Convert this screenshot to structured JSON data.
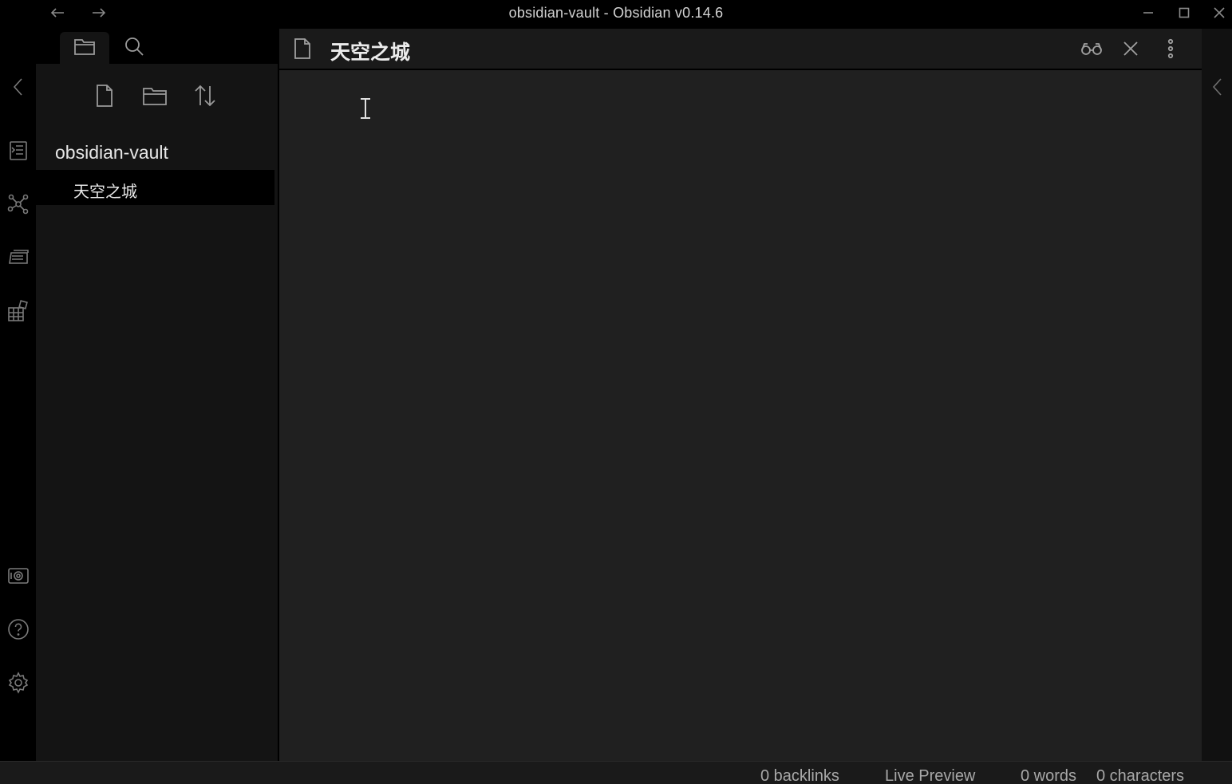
{
  "titlebar": {
    "title": "obsidian-vault - Obsidian v0.14.6",
    "back_icon": "arrow-left-icon",
    "forward_icon": "arrow-right-icon",
    "minimize_icon": "minimize-icon",
    "maximize_icon": "maximize-icon",
    "close_icon": "close-icon"
  },
  "ribbon": {
    "items": [
      {
        "icon": "chevron-left-icon"
      },
      {
        "icon": "command-palette-icon"
      },
      {
        "icon": "graph-view-icon"
      },
      {
        "icon": "slides-icon"
      },
      {
        "icon": "daily-notes-icon"
      },
      {
        "icon": "vault-icon"
      },
      {
        "icon": "help-icon"
      },
      {
        "icon": "settings-icon"
      }
    ]
  },
  "sidebar": {
    "tabs": [
      {
        "icon": "folder-icon",
        "active": true
      },
      {
        "icon": "search-icon",
        "active": false
      }
    ],
    "actions": [
      {
        "icon": "new-note-icon"
      },
      {
        "icon": "new-folder-icon"
      },
      {
        "icon": "sort-icon"
      }
    ],
    "vault_name": "obsidian-vault",
    "files": [
      {
        "name": "天空之城",
        "active": true
      }
    ]
  },
  "editor": {
    "title": "天空之城",
    "header_icons": [
      "reading-view-icon",
      "close-icon",
      "more-options-icon"
    ]
  },
  "statusbar": {
    "backlinks": "0 backlinks",
    "mode": "Live Preview",
    "words": "0 words",
    "characters": "0 characters"
  }
}
